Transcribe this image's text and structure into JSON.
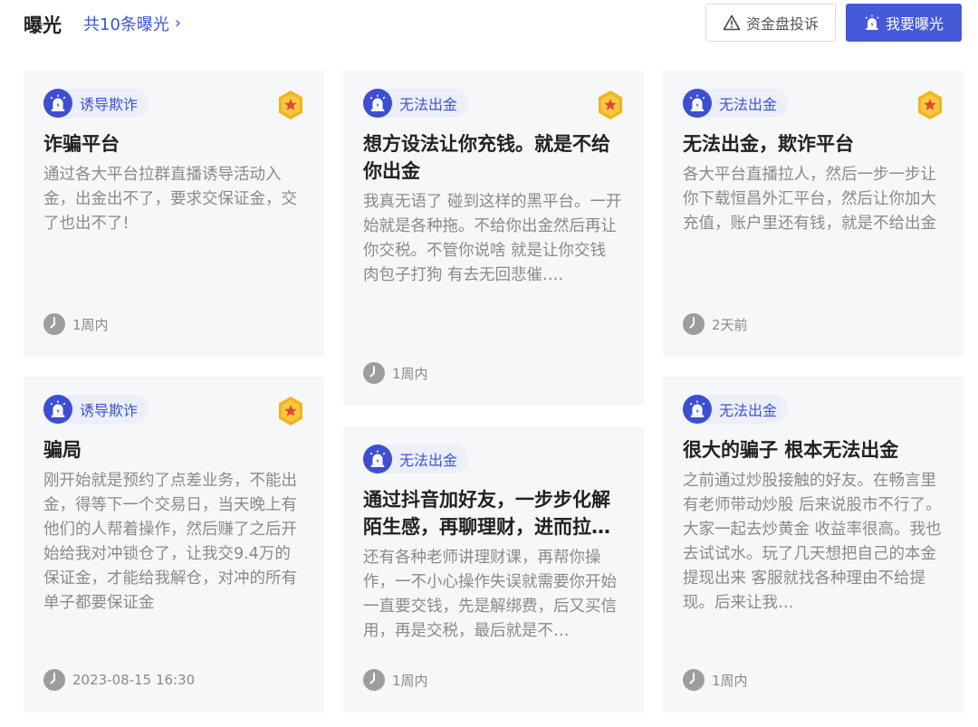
{
  "header": {
    "title": "曝光",
    "count_text": "共10条曝光",
    "complain_label": "资金盘投诉",
    "expose_label": "我要曝光"
  },
  "colors": {
    "accent": "#4659d8",
    "card_bg": "#f6f7f9",
    "tag_bg": "#eceef8",
    "muted": "#8a8a8a",
    "gold": "#f3b31d"
  },
  "cards": [
    {
      "tag": "诱导欺诈",
      "medal": true,
      "title": "诈骗平台",
      "body": "通过各大平台拉群直播诱导活动入金，出金出不了，要求交保证金，交了也出不了!",
      "time": "1周内"
    },
    {
      "tag": "无法出金",
      "medal": true,
      "title": "想方设法让你充钱。就是不给你出金",
      "body": "我真无语了 碰到这样的黑平台。一开始就是各种拖。不给你出金然后再让你交税。不管你说啥 就是让你交钱 肉包子打狗 有去无回悲催….",
      "time": "1周内"
    },
    {
      "tag": "无法出金",
      "medal": true,
      "title": "无法出金，欺诈平台",
      "body": "各大平台直播拉人，然后一步一步让你下载恒昌外汇平台，然后让你加大充值，账户里还有钱，就是不给出金",
      "time": "2天前"
    },
    {
      "tag": "诱导欺诈",
      "medal": true,
      "title": "骗局",
      "body": "刚开始就是预约了点差业务，不能出金，得等下一个交易日，当天晚上有他们的人帮着操作，然后赚了之后开始给我对冲锁仓了，让我交9.4万的保证金，才能给我解仓，对冲的所有单子都要保证金",
      "time": "2023-08-15 16:30"
    },
    {
      "tag": "无法出金",
      "medal": false,
      "title": "通过抖音加好友，一步步化解陌生感，再聊理财，进而拉…",
      "body": "还有各种老师讲理财课，再帮你操作，一不小心操作失误就需要你开始一直要交钱，先是解绑费，后又买信用，再是交税，最后就是不…",
      "time": "1周内"
    },
    {
      "tag": "无法出金",
      "medal": false,
      "title": "很大的骗子 根本无法出金",
      "body": "之前通过炒股接触的好友。在畅言里有老师带动炒股 后来说股市不行了。大家一起去炒黄金 收益率很高。我也去试试水。玩了几天想把自己的本金提现出来 客服就找各种理由不给提现。后来让我…",
      "time": "1周内"
    }
  ]
}
